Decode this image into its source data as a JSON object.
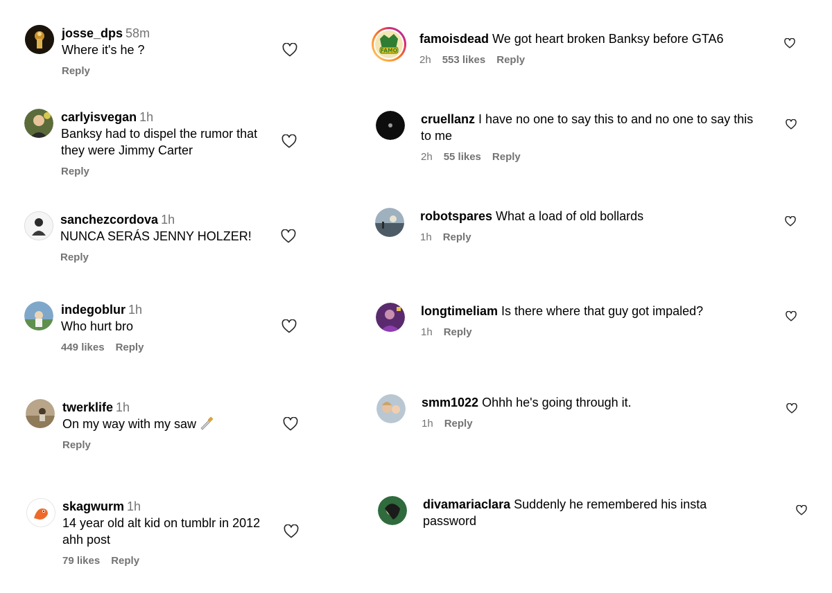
{
  "colors": {
    "text": "#000000",
    "muted": "#737373",
    "heart_stroke": "#262626",
    "background": "#ffffff"
  },
  "left_column": [
    {
      "username": "josse_dps",
      "age": "58m",
      "text": "Where it's he ?",
      "likes": "",
      "reply": "Reply"
    },
    {
      "username": "carlyisvegan",
      "age": "1h",
      "text_lines": [
        "Banksy had to dispel the rumor that",
        "they were Jimmy Carter"
      ],
      "likes": "",
      "reply": "Reply"
    },
    {
      "username": "sanchezcordova",
      "age": "1h",
      "text": "NUNCA SERÁS JENNY HOLZER!",
      "likes": "",
      "reply": "Reply"
    },
    {
      "username": "indegoblur",
      "age": "1h",
      "text": "Who hurt bro",
      "likes": "449 likes",
      "reply": "Reply"
    },
    {
      "username": "twerklife",
      "age": "1h",
      "text": "On my way with my saw",
      "emoji": "saw-icon",
      "likes": "",
      "reply": "Reply"
    },
    {
      "username": "skagwurm",
      "age": "1h",
      "text_lines": [
        "14 year old alt kid on tumblr in 2012",
        "ahh post"
      ],
      "likes": "79 likes",
      "reply": "Reply"
    }
  ],
  "right_column": [
    {
      "username": "famoisdead",
      "text": "We got heart broken Banksy before GTA6",
      "time": "2h",
      "likes": "553 likes",
      "reply": "Reply"
    },
    {
      "username": "cruellanz",
      "text_lines": [
        "I have no one to say this to and no one to say this",
        "to me"
      ],
      "time": "2h",
      "likes": "55 likes",
      "reply": "Reply"
    },
    {
      "username": "robotspares",
      "text": "What a load of old bollards",
      "time": "1h",
      "reply": "Reply"
    },
    {
      "username": "longtimeliam",
      "text": "Is there where that guy got impaled?",
      "time": "1h",
      "reply": "Reply"
    },
    {
      "username": "smm1022",
      "text": "Ohhh he's going through it.",
      "time": "1h",
      "reply": "Reply"
    },
    {
      "username": "divamariaclara",
      "text_lines": [
        "Suddenly he remembered his insta",
        "password"
      ]
    }
  ],
  "famo_badge": "FAMO",
  "icons": {
    "like": "heart-outline-icon",
    "saw": "saw-icon"
  }
}
